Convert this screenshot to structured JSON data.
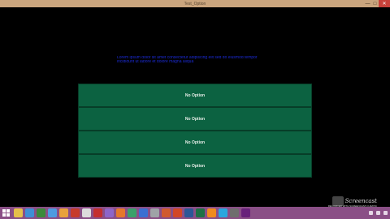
{
  "window": {
    "title": "Test_Option",
    "buttons": {
      "minimize": "—",
      "maximize": "□",
      "close": "✕"
    }
  },
  "question": {
    "line1": "Lorem ipsum dolor sit amet consectetur adipiscing elit sed do eiusmod tempor",
    "line2": "incididunt ut labore et dolore magna aliqua"
  },
  "options": [
    {
      "label": "No Option"
    },
    {
      "label": "No Option"
    },
    {
      "label": "No Option"
    },
    {
      "label": "No Option"
    }
  ],
  "taskbar": {
    "icons": [
      {
        "name": "file-explorer-icon",
        "color": "#e5c04a"
      },
      {
        "name": "ie-icon",
        "color": "#3f8fd6"
      },
      {
        "name": "media-player-icon",
        "color": "#3b8a3b"
      },
      {
        "name": "chrome-icon",
        "color": "#4e9be0"
      },
      {
        "name": "paint-icon",
        "color": "#e9a13b"
      },
      {
        "name": "pdf-icon",
        "color": "#c63b2b"
      },
      {
        "name": "notepad-icon",
        "color": "#dcdcdc"
      },
      {
        "name": "maps-icon",
        "color": "#c42f2f"
      },
      {
        "name": "photos-icon",
        "color": "#8d65c9"
      },
      {
        "name": "firefox-icon",
        "color": "#e5782b"
      },
      {
        "name": "globe-icon",
        "color": "#3aa06a"
      },
      {
        "name": "store-icon",
        "color": "#3b6fd1"
      },
      {
        "name": "calculator-icon",
        "color": "#9fa3a7"
      },
      {
        "name": "music-icon",
        "color": "#d05a2f"
      },
      {
        "name": "powerpoint-icon",
        "color": "#d24726"
      },
      {
        "name": "word-icon",
        "color": "#2b5797"
      },
      {
        "name": "excel-icon",
        "color": "#1e7145"
      },
      {
        "name": "vlc-icon",
        "color": "#f08b1d"
      },
      {
        "name": "skype-icon",
        "color": "#2aa6df"
      },
      {
        "name": "settings-icon",
        "color": "#6e6e6e"
      },
      {
        "name": "visual-studio-icon",
        "color": "#68217a"
      }
    ]
  },
  "watermark": {
    "text": "Screencast",
    "sub": "RECORDED WITH SCREENCAST-O-MATIC"
  }
}
